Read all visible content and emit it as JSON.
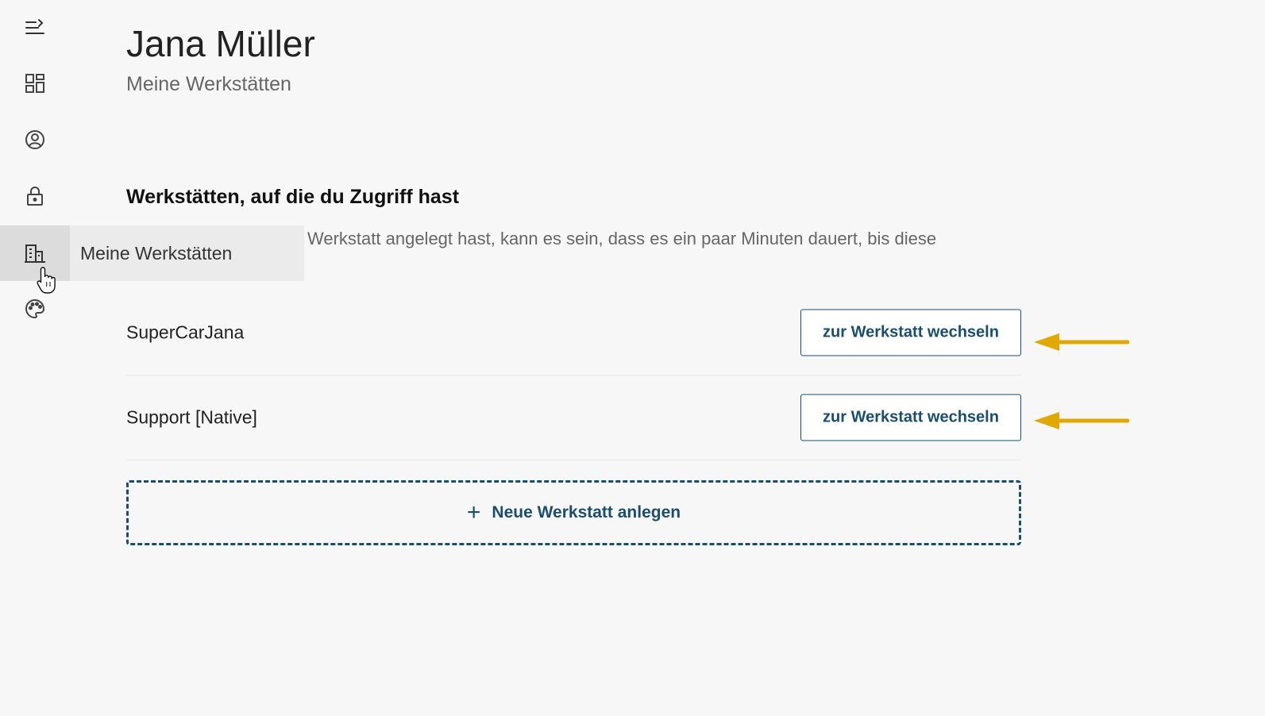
{
  "header": {
    "name": "Jana Müller",
    "subtitle": "Meine Werkstätten"
  },
  "sidebar": {
    "items": [
      {
        "icon": "menu-expand-icon"
      },
      {
        "icon": "dashboard-icon"
      },
      {
        "icon": "account-icon"
      },
      {
        "icon": "lock-icon"
      },
      {
        "icon": "building-icon",
        "active": true
      },
      {
        "icon": "palette-icon"
      }
    ],
    "tooltip": "Meine Werkstätten"
  },
  "section": {
    "title": "Werkstätten, auf die du Zugriff hast",
    "info_visible": "Werkstatt angelegt hast, kann es sein, dass es ein paar Minuten dauert, bis diese"
  },
  "workshops": [
    {
      "name": "SuperCarJana",
      "button_label": "zur Werkstatt wechseln"
    },
    {
      "name": "Support [Native]",
      "button_label": "zur Werkstatt wechseln"
    }
  ],
  "new_workshop": {
    "plus": "+",
    "label": "Neue Werkstatt anlegen"
  },
  "colors": {
    "accent": "#1a4e6b",
    "arrow": "#e0a800",
    "background": "#f7f7f7"
  }
}
